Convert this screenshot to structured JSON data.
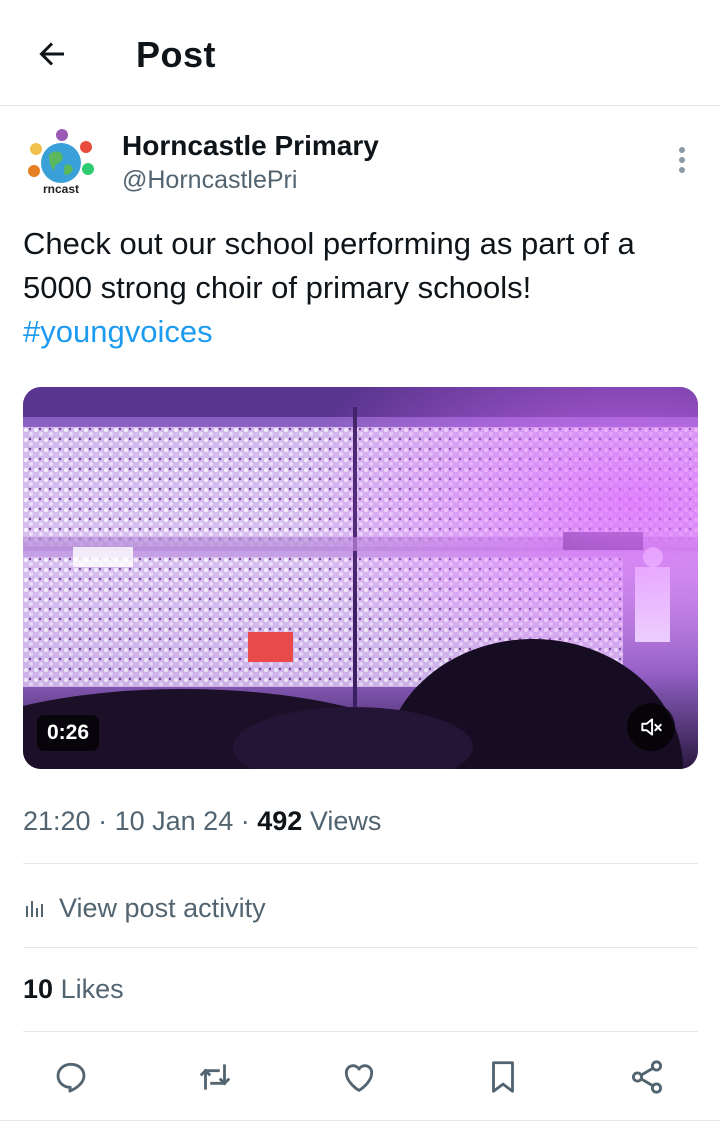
{
  "header": {
    "title": "Post",
    "back_icon": "arrow-left-icon"
  },
  "author": {
    "display_name": "Horncastle Primary",
    "handle": "@HorncastlePri",
    "avatar_text": "rncast"
  },
  "post": {
    "text": "Check out our school performing as part of a 5000 strong choir of primary schools!",
    "hashtag": "#youngvoices"
  },
  "video": {
    "duration": "0:26",
    "muted": true
  },
  "meta": {
    "time": "21:20",
    "separator": "·",
    "date": "10 Jan 24",
    "views_count": "492",
    "views_label": "Views"
  },
  "activity": {
    "label": "View post activity"
  },
  "likes": {
    "count": "10",
    "label": "Likes"
  },
  "actions": [
    "reply-icon",
    "repost-icon",
    "like-icon",
    "bookmark-icon",
    "share-icon"
  ],
  "colors": {
    "link": "#1d9bf0",
    "secondary_text": "#536471",
    "primary_text": "#0f1419",
    "divider": "#e6e9eb"
  }
}
